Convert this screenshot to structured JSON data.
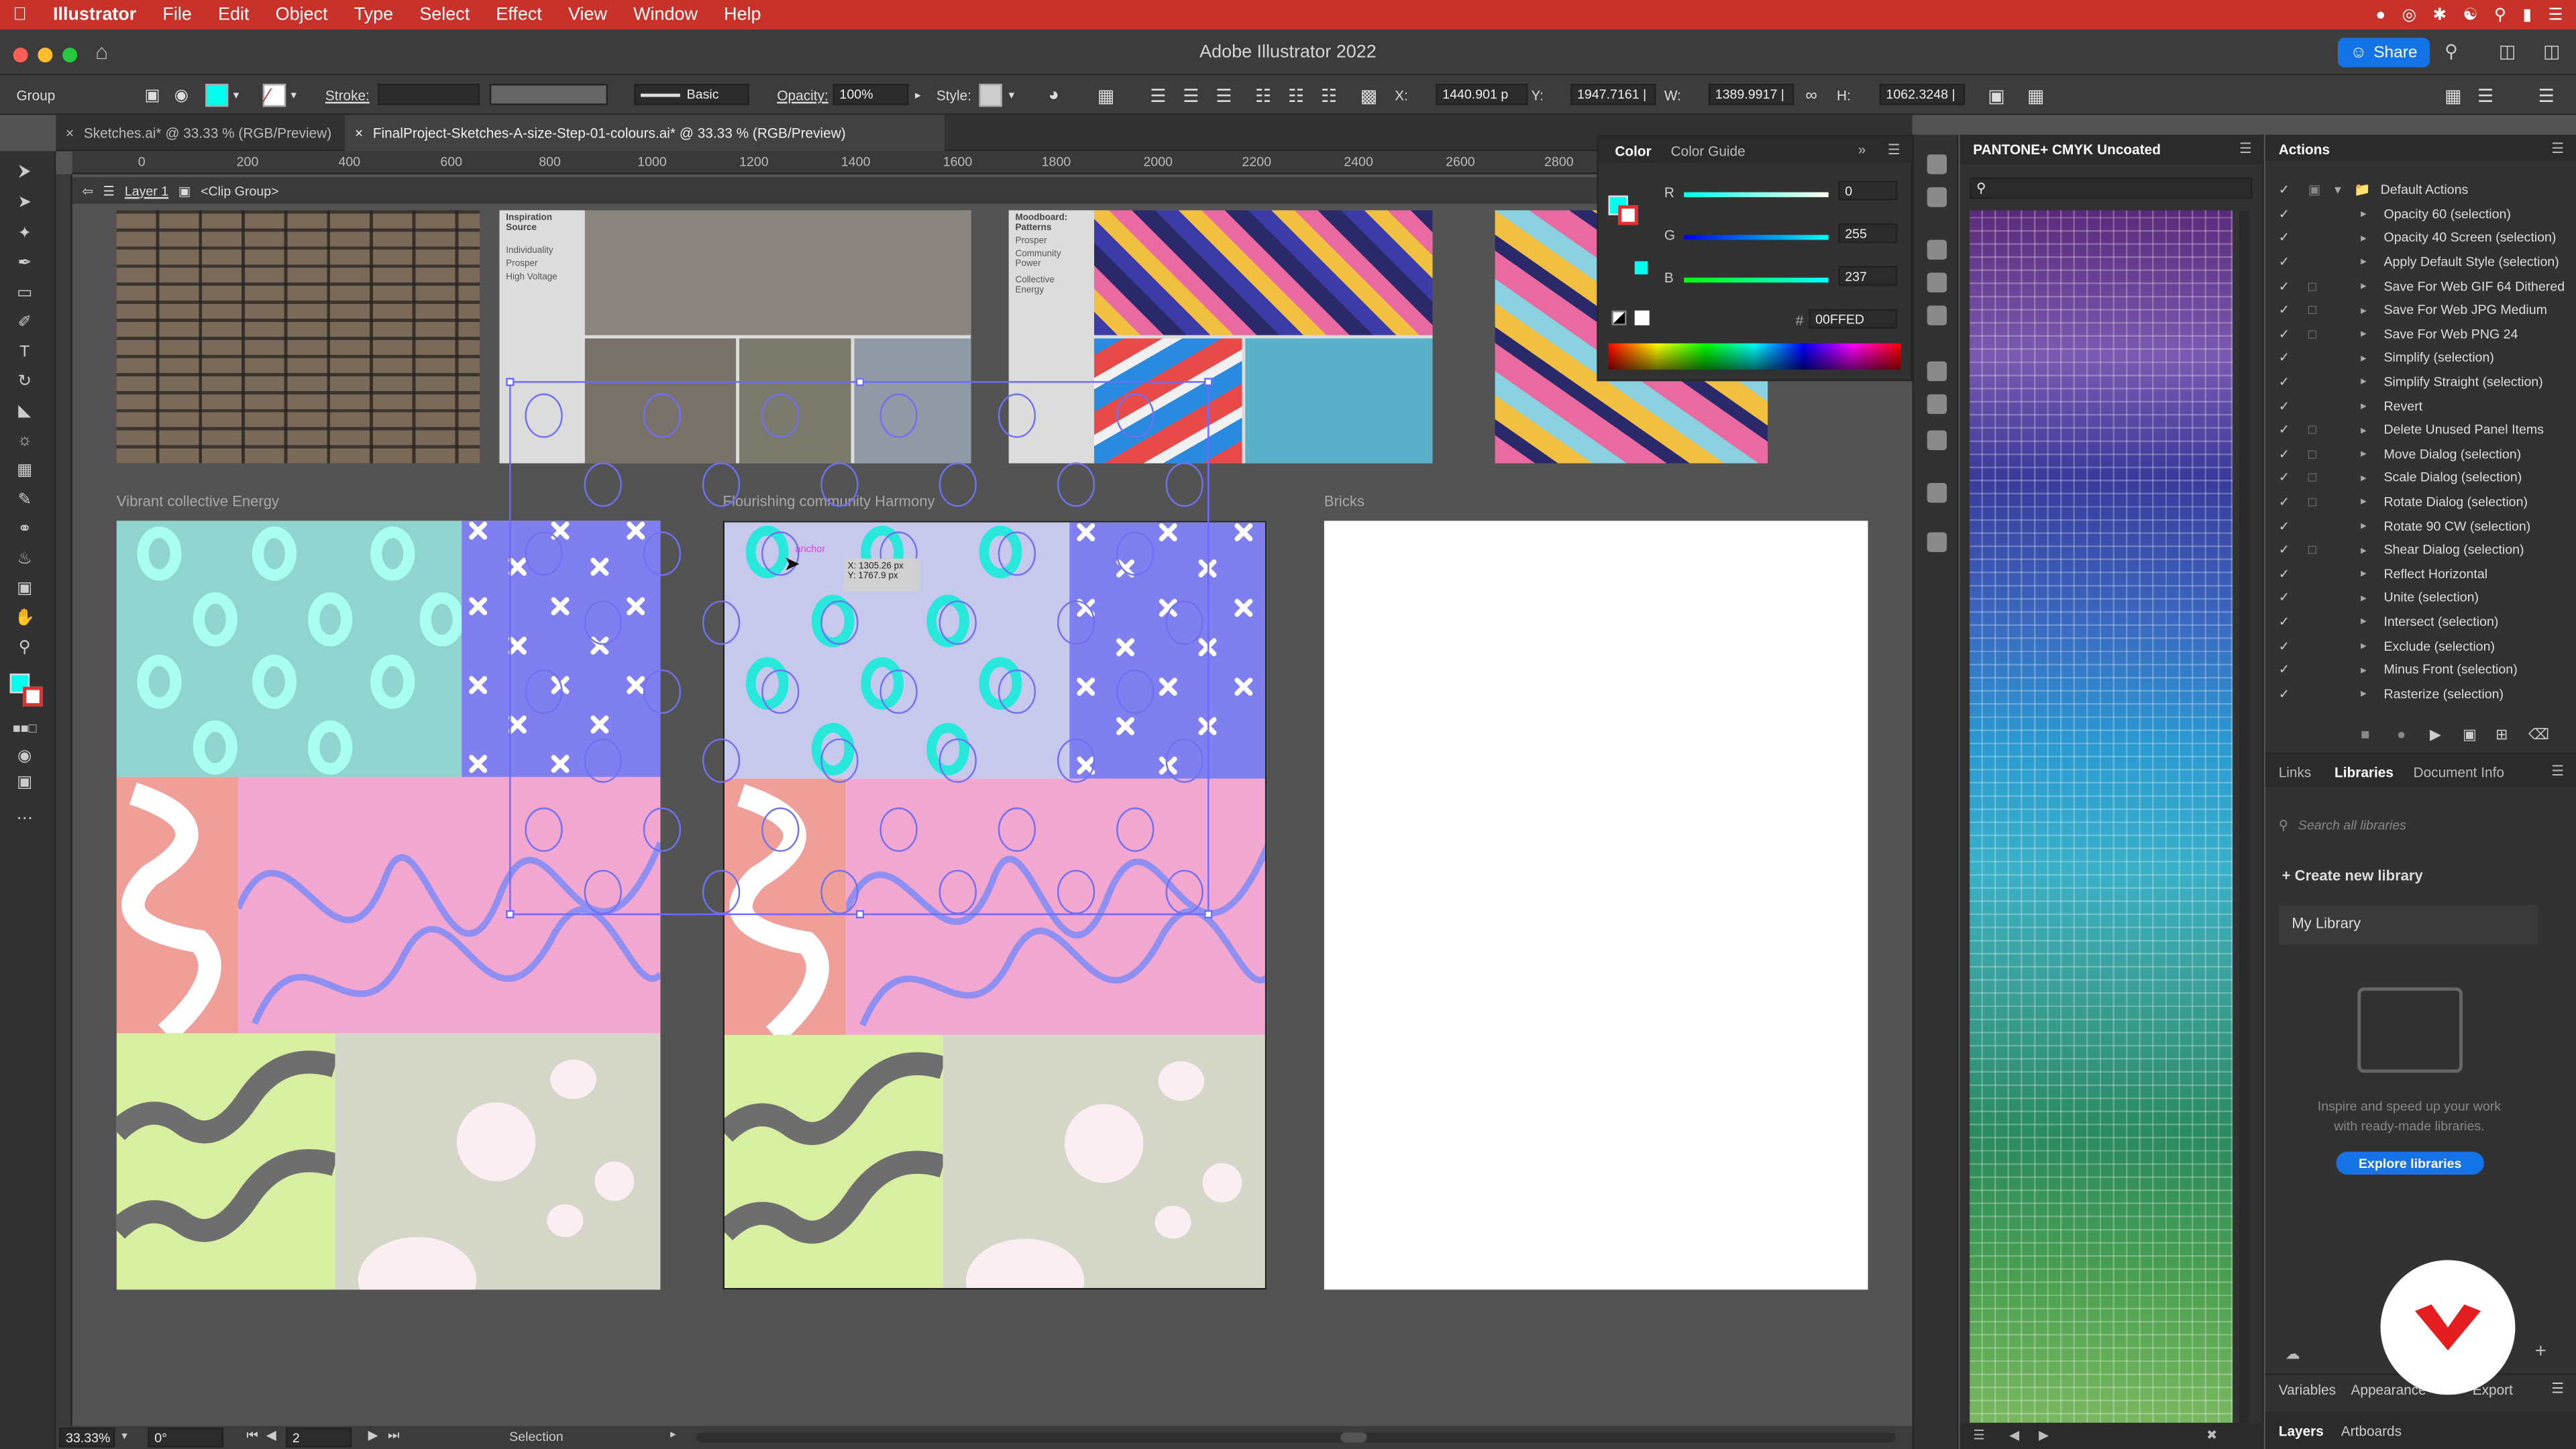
{
  "menubar": {
    "items": [
      "Illustrator",
      "File",
      "Edit",
      "Object",
      "Type",
      "Select",
      "Effect",
      "View",
      "Window",
      "Help"
    ]
  },
  "titlebar": {
    "title": "Adobe Illustrator 2022",
    "share_label": "Share"
  },
  "controlbar": {
    "group_label": "Group",
    "stroke_label": "Stroke:",
    "brush_label": "Basic",
    "opacity_label": "Opacity:",
    "opacity_value": "100%",
    "style_label": "Style:",
    "x_label": "X:",
    "x_value": "1440.901 p",
    "y_label": "Y:",
    "y_value": "1947.7161 |",
    "w_label": "W:",
    "w_value": "1389.9917 |",
    "h_label": "H:",
    "h_value": "1062.3248 |"
  },
  "tabs": [
    {
      "label": "Sketches.ai* @ 33.33 % (RGB/Preview)"
    },
    {
      "label": "FinalProject-Sketches-A-size-Step-01-colours.ai* @ 33.33 % (RGB/Preview)"
    }
  ],
  "ruler": {
    "ticks": [
      "0",
      "200",
      "400",
      "600",
      "800",
      "1000",
      "1200",
      "1400",
      "1600",
      "1800",
      "2000",
      "2200",
      "2400",
      "2600",
      "2800"
    ]
  },
  "breadcrumb": {
    "layer": "Layer 1",
    "group": "<Clip Group>"
  },
  "canvas": {
    "moodboard1": {
      "title": "Inspiration Source",
      "words": [
        "Individuality",
        "Prosper",
        "High Voltage"
      ]
    },
    "moodboard2": {
      "title": "Moodboard: Patterns",
      "words": [
        "Prosper",
        "Community Power",
        "Collective Energy"
      ]
    },
    "artboards": [
      "Vibrant collective Energy",
      "Flourishing community Harmony",
      "Bricks"
    ],
    "tooltip": {
      "anchor": "anchor",
      "x": "X: 1305.26 px",
      "y": "Y: 1767.9 px"
    }
  },
  "statusbar": {
    "zoom": "33.33%",
    "rotation": "0°",
    "artboard": "2",
    "tool": "Selection"
  },
  "colorpanel": {
    "tab1": "Color",
    "tab2": "Color Guide",
    "r_label": "R",
    "r_value": "0",
    "g_label": "G",
    "g_value": "255",
    "b_label": "B",
    "b_value": "237",
    "hex_label": "#",
    "hex_value": "00FFED",
    "fill_color": "#00FFED"
  },
  "swatchpanel": {
    "title": "PANTONE+ CMYK Uncoated"
  },
  "actions": {
    "title": "Actions",
    "set_name": "Default Actions",
    "items": [
      "Opacity 60 (selection)",
      "Opacity 40 Screen (selection)",
      "Apply Default Style (selection)",
      "Save For Web GIF 64 Dithered",
      "Save For Web JPG Medium",
      "Save For Web PNG 24",
      "Simplify (selection)",
      "Simplify Straight (selection)",
      "Revert",
      "Delete Unused Panel Items",
      "Move Dialog (selection)",
      "Scale Dialog (selection)",
      "Rotate Dialog (selection)",
      "Rotate 90 CW (selection)",
      "Shear Dialog (selection)",
      "Reflect Horizontal",
      "Unite (selection)",
      "Intersect (selection)",
      "Exclude (selection)",
      "Minus Front (selection)",
      "Rasterize (selection)"
    ]
  },
  "libraries": {
    "tabs": [
      "Links",
      "Libraries",
      "Document Info"
    ],
    "search_placeholder": "Search all libraries",
    "create_label": "Create new library",
    "my_library": "My Library",
    "promo_line1": "Inspire and speed up your work",
    "promo_line2": "with ready-made libraries.",
    "explore_label": "Explore libraries"
  },
  "bottomtabs": {
    "row1": [
      "Variables",
      "Appearance",
      "Export"
    ],
    "row2": [
      "Layers",
      "Artboards"
    ]
  }
}
